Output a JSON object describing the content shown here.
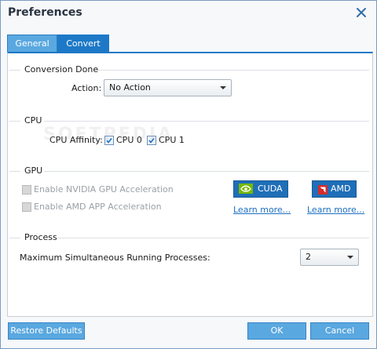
{
  "window": {
    "title": "Preferences"
  },
  "tabs": [
    {
      "label": "General"
    },
    {
      "label": "Convert"
    }
  ],
  "conversion_done": {
    "title": "Conversion Done",
    "action_label": "Action:",
    "action_value": "No Action"
  },
  "cpu": {
    "title": "CPU",
    "affinity_label": "CPU Affinity:",
    "cpu0_label": "CPU 0",
    "cpu1_label": "CPU 1",
    "cpu0_checked": true,
    "cpu1_checked": true
  },
  "gpu": {
    "title": "GPU",
    "nvidia_label": "Enable NVIDIA GPU Acceleration",
    "amd_label": "Enable AMD APP Acceleration",
    "cuda_button": "CUDA",
    "amd_button": "AMD",
    "learn_more_1": "Learn more...",
    "learn_more_2": "Learn more..."
  },
  "process": {
    "title": "Process",
    "max_label": "Maximum Simultaneous Running Processes:",
    "max_value": "2"
  },
  "footer": {
    "restore_label": "Restore Defaults",
    "ok_label": "OK",
    "cancel_label": "Cancel"
  },
  "watermark": "SOFTPEDIA",
  "colors": {
    "accent": "#1d79c7",
    "tab_inactive": "#5aa8e0",
    "link": "#1d6fc0"
  }
}
